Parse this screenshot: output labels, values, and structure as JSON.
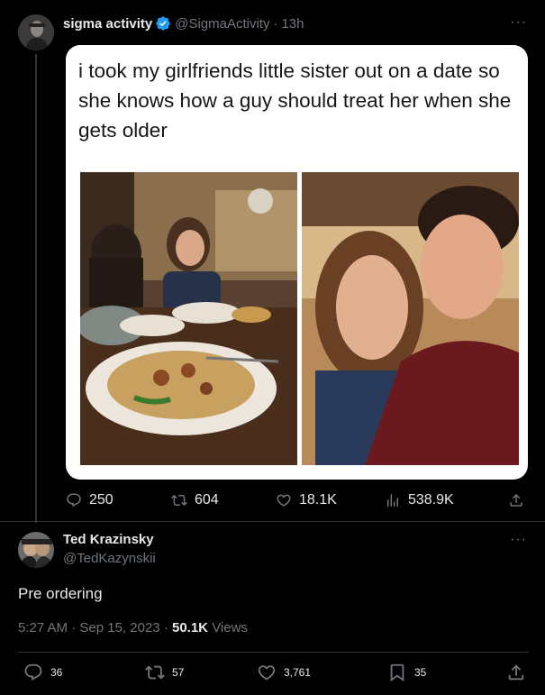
{
  "tweet1": {
    "author_name": "sigma activity",
    "author_handle": "@SigmaActivity",
    "separator": "·",
    "time": "13h",
    "more": "···",
    "caption": "i took my girlfriends little sister out on a date so she knows how a guy should treat her when she gets older",
    "stats": {
      "replies": "250",
      "reposts": "604",
      "likes": "18.1K",
      "views": "538.9K"
    }
  },
  "tweet2": {
    "author_name": "Ted Krazinsky",
    "author_handle": "@TedKazynskii",
    "more": "···",
    "text": "Pre ordering",
    "time": "5:27 AM",
    "date": "Sep 15, 2023",
    "dot": "·",
    "views_count": "50.1K",
    "views_label": "Views",
    "stats": {
      "replies": "36",
      "reposts": "57",
      "likes": "3,761",
      "bookmarks": "35"
    }
  },
  "colors": {
    "background": "#000000",
    "text_primary": "#e7e9ea",
    "text_muted": "#71767b",
    "verified": "#1d9bf0",
    "divider": "#2f3336"
  },
  "icons": [
    "verified-badge-icon",
    "reply-icon",
    "repost-icon",
    "like-icon",
    "views-icon",
    "share-icon",
    "bookmark-icon",
    "more-icon"
  ]
}
